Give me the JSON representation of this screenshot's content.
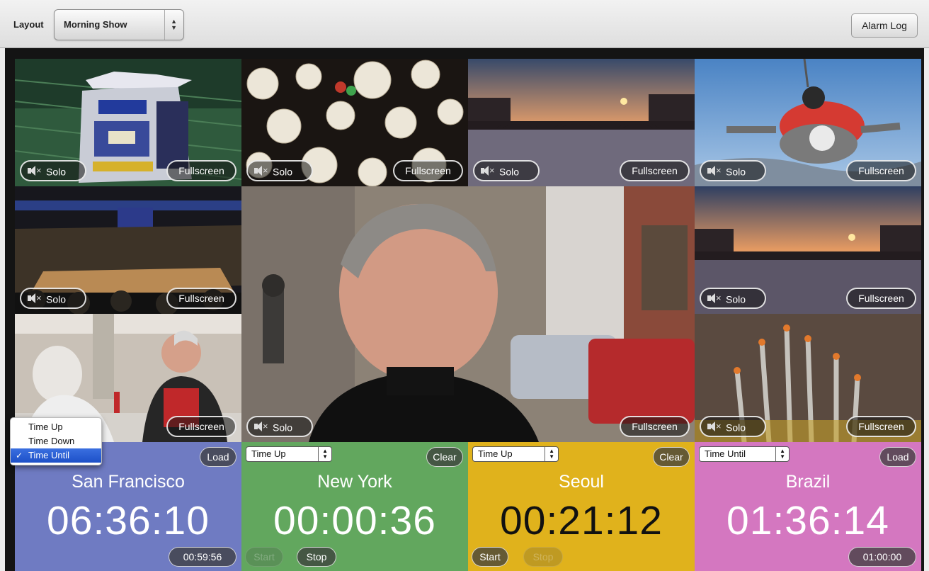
{
  "toolbar": {
    "layout_label": "Layout",
    "layout_value": "Morning Show",
    "alarm_log_label": "Alarm Log"
  },
  "tile_labels": {
    "solo": "Solo",
    "fullscreen": "Fullscreen"
  },
  "tiles": [
    {
      "id": "arena-scoreboard",
      "solo": true,
      "fullscreen": true
    },
    {
      "id": "paper-lanterns",
      "solo": true,
      "fullscreen": true
    },
    {
      "id": "bridge-sunset-1",
      "solo": true,
      "fullscreen": true
    },
    {
      "id": "skydivers",
      "solo": true,
      "fullscreen": true
    },
    {
      "id": "arena-crowd",
      "solo": true,
      "fullscreen": true
    },
    {
      "id": "man-portrait-main",
      "solo": true,
      "fullscreen": true
    },
    {
      "id": "bridge-sunset-2",
      "solo": true,
      "fullscreen": true
    },
    {
      "id": "diner-ladies",
      "solo": false,
      "fullscreen": true
    },
    {
      "id": "incense-sticks",
      "solo": true,
      "fullscreen": true
    }
  ],
  "clocks": [
    {
      "city": "San Francisco",
      "mode": "Time Until",
      "time": "06:36:10",
      "top_button": "Load",
      "countdown": "00:59:56",
      "color": "#6f7bc2"
    },
    {
      "city": "New York",
      "mode": "Time Up",
      "time": "00:00:36",
      "top_button": "Clear",
      "start": "Start",
      "stop": "Stop",
      "start_enabled": false,
      "stop_enabled": true,
      "color": "#62a75e"
    },
    {
      "city": "Seoul",
      "mode": "Time Up",
      "time": "00:21:12",
      "top_button": "Clear",
      "start": "Start",
      "stop": "Stop",
      "start_enabled": true,
      "stop_enabled": false,
      "color": "#e0b21c"
    },
    {
      "city": "Brazil",
      "mode": "Time Until",
      "time": "01:36:14",
      "top_button": "Load",
      "countdown": "01:00:00",
      "color": "#d477c0"
    }
  ],
  "mode_dropdown": {
    "options": [
      "Time Up",
      "Time Down",
      "Time Until"
    ],
    "selected": "Time Until"
  }
}
